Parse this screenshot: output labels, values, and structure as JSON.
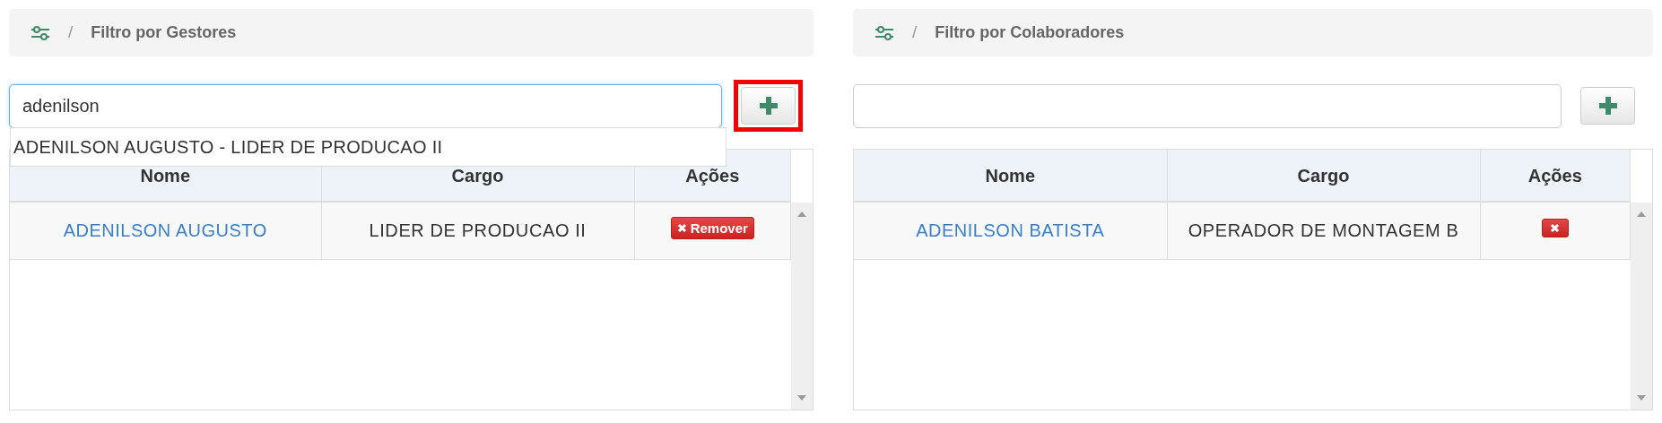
{
  "panels": [
    {
      "breadcrumb": {
        "separator": "/",
        "title": "Filtro por Gestores"
      },
      "search": {
        "value": "adenilson",
        "focused": true
      },
      "add_button": {
        "highlighted": true
      },
      "suggestions": [
        "ADENILSON AUGUSTO - LIDER DE PRODUCAO II"
      ],
      "table": {
        "columns": [
          "Nome",
          "Cargo",
          "Ações"
        ],
        "rows": [
          {
            "nome": "ADENILSON AUGUSTO",
            "cargo": "LIDER DE PRODUCAO II",
            "action": {
              "kind": "labeled",
              "label": "Remover"
            }
          }
        ]
      }
    },
    {
      "breadcrumb": {
        "separator": "/",
        "title": "Filtro por Colaboradores"
      },
      "search": {
        "focused": false
      },
      "add_button": {
        "highlighted": false
      },
      "table": {
        "columns": [
          "Nome",
          "Cargo",
          "Ações"
        ],
        "rows": [
          {
            "nome": "ADENILSON BATISTA",
            "cargo": "OPERADOR DE MONTAGEM B",
            "action": {
              "kind": "icon"
            }
          }
        ]
      }
    }
  ]
}
